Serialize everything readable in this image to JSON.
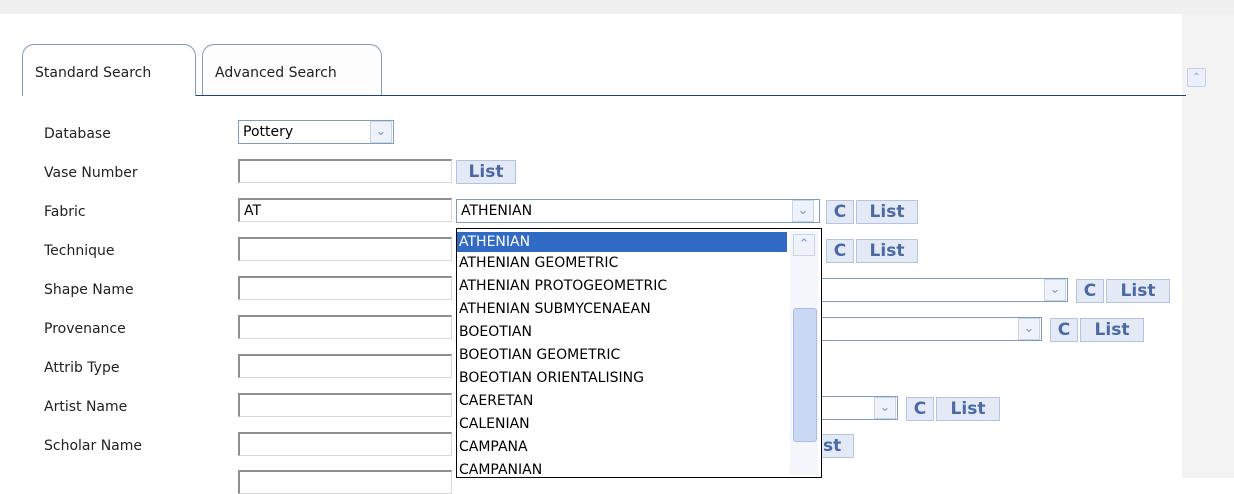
{
  "tabs": {
    "standard": "Standard Search",
    "advanced": "Advanced Search"
  },
  "labels": {
    "database": "Database",
    "vase_number": "Vase Number",
    "fabric": "Fabric",
    "technique": "Technique",
    "shape_name": "Shape Name",
    "provenance": "Provenance",
    "attrib_type": "Attrib Type",
    "artist_name": "Artist Name",
    "scholar_name": "Scholar Name"
  },
  "values": {
    "database": "Pottery",
    "fabric_input": "AT",
    "fabric_select": "ATHENIAN"
  },
  "buttons": {
    "list": "List",
    "clear": "C",
    "partial_list": "st"
  },
  "dropdown_options": [
    "ATHENIAN",
    "ATHENIAN GEOMETRIC",
    "ATHENIAN PROTOGEOMETRIC",
    "ATHENIAN SUBMYCENAEAN",
    "BOEOTIAN",
    "BOEOTIAN GEOMETRIC",
    "BOEOTIAN ORIENTALISING",
    "CAERETAN",
    "CALENIAN",
    "CAMPANA",
    "CAMPANIAN"
  ],
  "icons": {
    "dropdown_arrow": "⌄",
    "scroll_up": "⌃"
  },
  "colors": {
    "tab_border": "#7f9db9",
    "tab_line": "#1f3f7f",
    "button_text": "#4b6aa5",
    "selection": "#316ac5"
  }
}
